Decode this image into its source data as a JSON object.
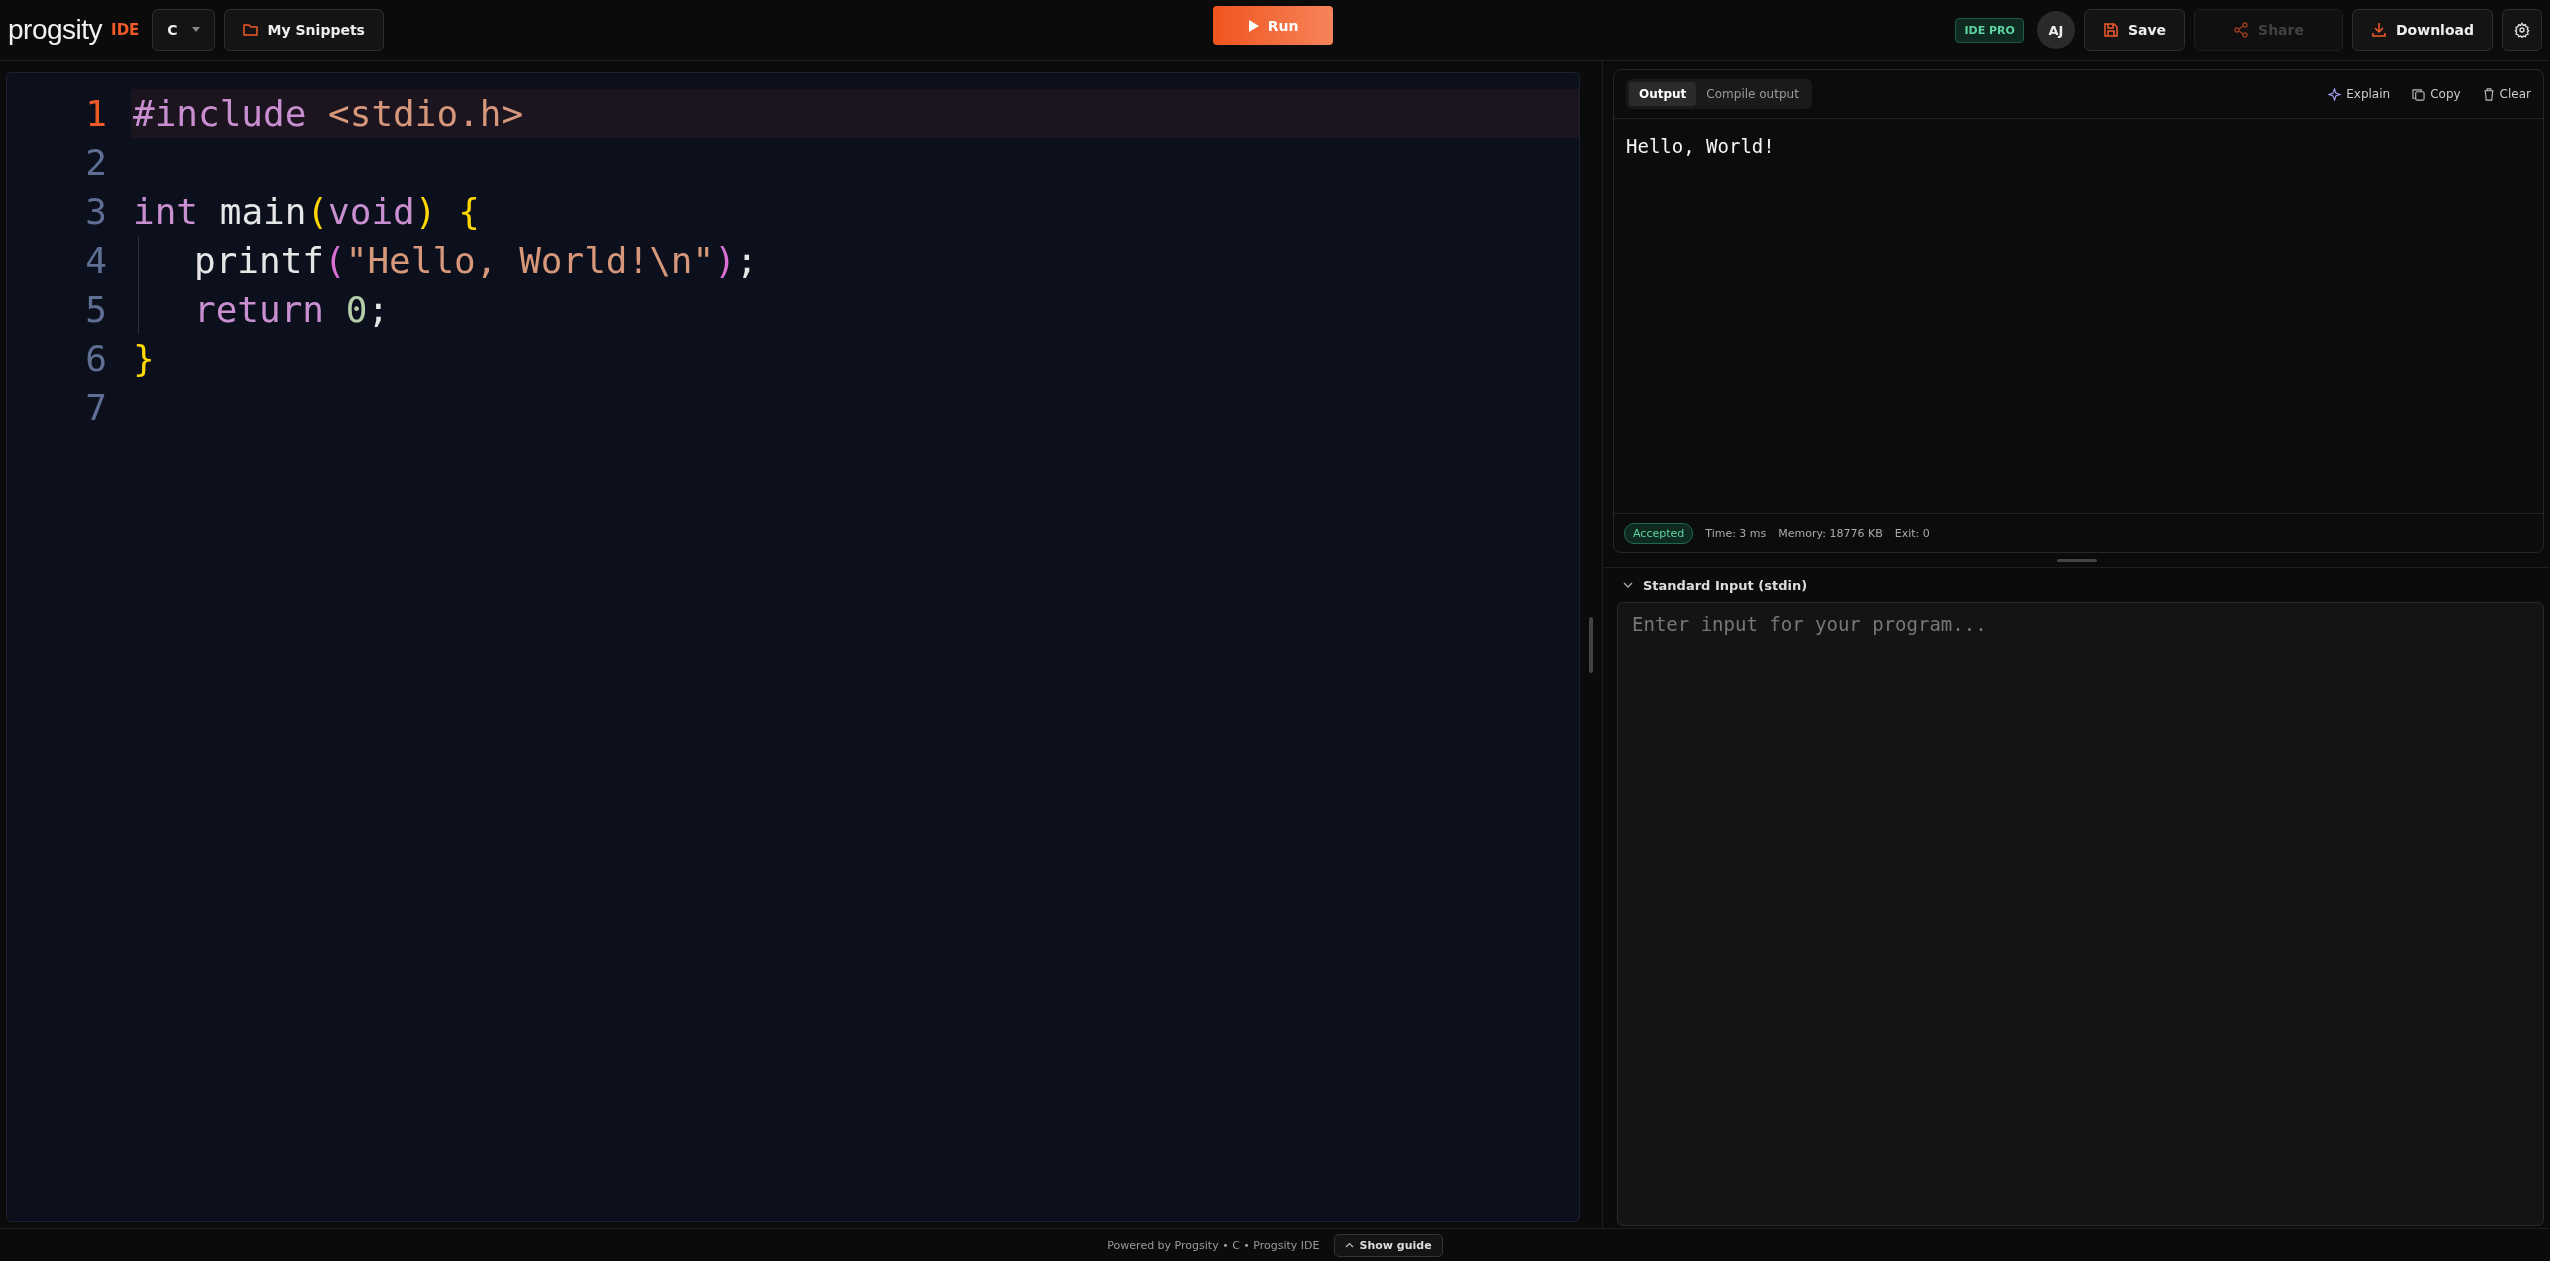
{
  "header": {
    "logo": "progsity",
    "logo_suffix": "IDE",
    "language": "C",
    "snippets_button": "My Snippets",
    "run_button": "Run",
    "plan_badge": "IDE PRO",
    "avatar": "AJ",
    "actions": [
      {
        "label": "Save",
        "kind": "save",
        "disabled": false
      },
      {
        "label": "Share",
        "kind": "share",
        "disabled": true
      },
      {
        "label": "Download",
        "kind": "download",
        "disabled": false
      }
    ]
  },
  "editor": {
    "lines": [
      {
        "number": "1",
        "active": true,
        "indented": false,
        "tokens": [
          {
            "text": "#include",
            "kind": "keyword"
          },
          {
            "text": " <stdio.h>",
            "kind": "string"
          }
        ]
      },
      {
        "number": "2",
        "active": false
      },
      {
        "number": "3",
        "active": false,
        "indented": false,
        "tokens": [
          {
            "text": "int",
            "kind": "keyword"
          },
          {
            "text": " main",
            "kind": "plain"
          },
          {
            "text": "(",
            "kind": "bracket1"
          },
          {
            "text": "void",
            "kind": "keyword"
          },
          {
            "text": ")",
            "kind": "bracket1"
          },
          {
            "text": " {",
            "kind": "bracket1"
          }
        ]
      },
      {
        "number": "4",
        "active": false,
        "indented": true,
        "tokens": [
          {
            "text": "printf",
            "kind": "plain"
          },
          {
            "text": "(",
            "kind": "bracket2"
          },
          {
            "text": "\"Hello, World!\\n\"",
            "kind": "string"
          },
          {
            "text": ")",
            "kind": "bracket2"
          },
          {
            "text": ";",
            "kind": "plain"
          }
        ]
      },
      {
        "number": "5",
        "active": false,
        "indented": true,
        "tokens": [
          {
            "text": "return",
            "kind": "keyword"
          },
          {
            "text": " 0",
            "kind": "number"
          },
          {
            "text": ";",
            "kind": "plain"
          }
        ]
      },
      {
        "number": "6",
        "active": false,
        "indented": false,
        "tokens": [
          {
            "text": "}",
            "kind": "bracket1"
          }
        ]
      },
      {
        "number": "7",
        "active": false
      }
    ]
  },
  "output": {
    "tabs": [
      {
        "label": "Output",
        "selected": true
      },
      {
        "label": "Compile output",
        "selected": false
      }
    ],
    "actions": [
      {
        "label": "Explain",
        "kind": "explain"
      },
      {
        "label": "Copy",
        "kind": "copy"
      },
      {
        "label": "Clear",
        "kind": "clear"
      }
    ],
    "text": "Hello, World!",
    "status": "Accepted",
    "stats": [
      "Time: 3 ms",
      "Memory: 18776 KB",
      "Exit: 0"
    ]
  },
  "stdin": {
    "title": "Standard Input (stdin)",
    "expanded": true,
    "placeholder": "Enter input for your program..."
  },
  "footer": {
    "text": "Powered by Progsity • C • Progsity IDE",
    "guide_button": "Show guide"
  }
}
